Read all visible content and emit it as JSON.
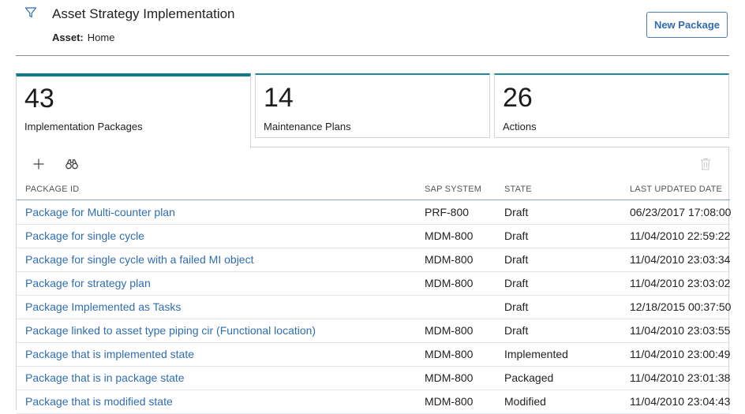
{
  "header": {
    "title": "Asset Strategy Implementation",
    "asset_label": "Asset:",
    "asset_value": "Home",
    "new_package_label": "New Package"
  },
  "tiles": [
    {
      "count": "43",
      "label": "Implementation Packages"
    },
    {
      "count": "14",
      "label": "Maintenance Plans"
    },
    {
      "count": "26",
      "label": "Actions"
    }
  ],
  "table": {
    "columns": [
      "PACKAGE ID",
      "SAP SYSTEM",
      "STATE",
      "LAST UPDATED DATE"
    ],
    "rows": [
      {
        "id": "Package for Multi-counter plan",
        "sap": "PRF-800",
        "state": "Draft",
        "date": "06/23/2017 17:08:00"
      },
      {
        "id": "Package for single cycle",
        "sap": "MDM-800",
        "state": "Draft",
        "date": "11/04/2010 22:59:22"
      },
      {
        "id": "Package for single cycle with a failed MI object",
        "sap": "MDM-800",
        "state": "Draft",
        "date": "11/04/2010 23:03:34"
      },
      {
        "id": "Package for strategy plan",
        "sap": "MDM-800",
        "state": "Draft",
        "date": "11/04/2010 23:03:02"
      },
      {
        "id": "Package Implemented as Tasks",
        "sap": "",
        "state": "Draft",
        "date": "12/18/2015 00:37:50"
      },
      {
        "id": "Package linked to asset type piping cir (Functional location)",
        "sap": "MDM-800",
        "state": "Draft",
        "date": "11/04/2010 23:03:55"
      },
      {
        "id": "Package that is implemented state",
        "sap": "MDM-800",
        "state": "Implemented",
        "date": "11/04/2010 23:00:49"
      },
      {
        "id": "Package that is in package state",
        "sap": "MDM-800",
        "state": "Packaged",
        "date": "11/04/2010 23:01:38"
      },
      {
        "id": "Package that is modified state",
        "sap": "MDM-800",
        "state": "Modified",
        "date": "11/04/2010 23:04:43"
      }
    ]
  },
  "icons": {
    "filter": "filter-icon",
    "add": "plus-icon",
    "find": "binoculars-icon",
    "delete": "trash-icon"
  },
  "colors": {
    "accent": "#12798a",
    "link": "#2f6db0",
    "border": "#cfd4d8"
  }
}
